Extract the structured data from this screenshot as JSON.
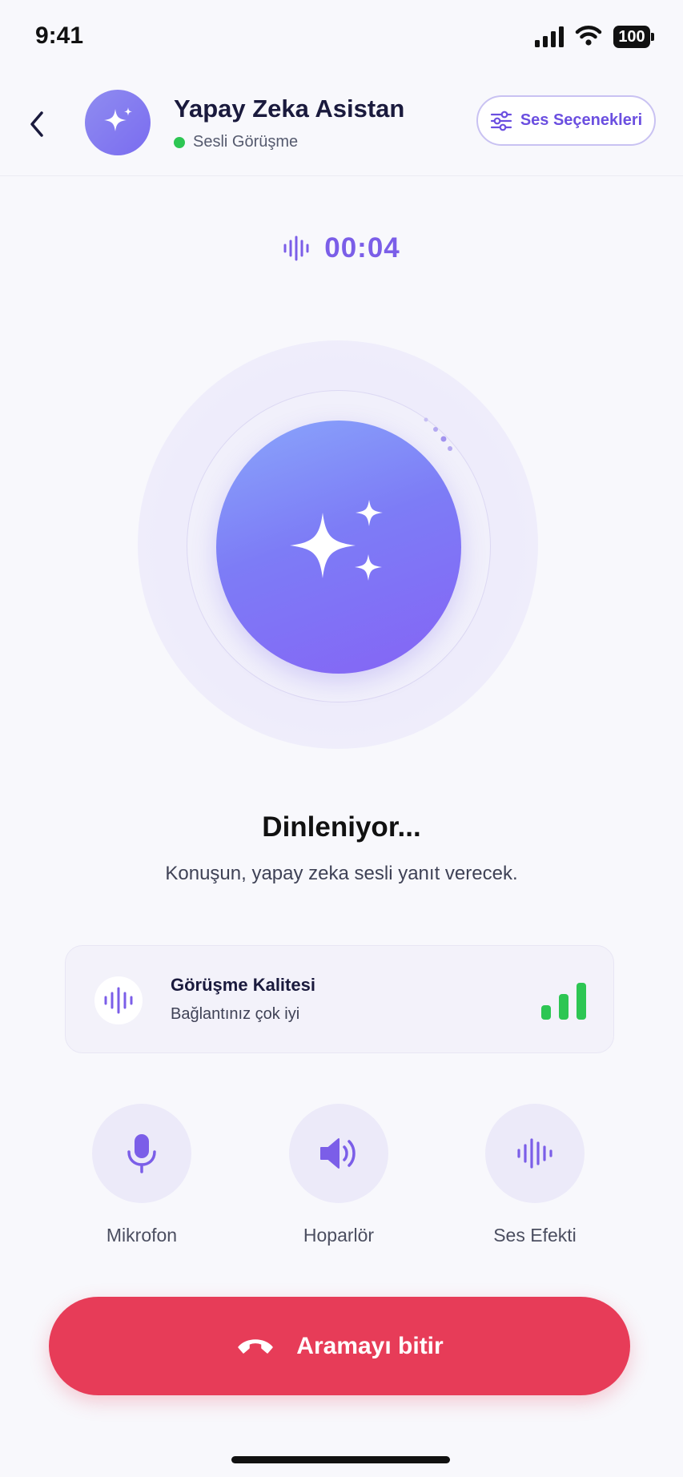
{
  "status_bar": {
    "time": "9:41",
    "battery": "100"
  },
  "header": {
    "title": "Yapay Zeka Asistan",
    "status": "Sesli Görüşme",
    "status_color": "#2dc653",
    "options_label": "Ses Seçenekleri",
    "avatar_icon": "sparkle-icon"
  },
  "timer": {
    "value": "00:04",
    "icon": "waveform-icon"
  },
  "orb": {
    "icon": "sparkles-icon",
    "accent": "#7d6cf6"
  },
  "listening": {
    "title": "Dinleniyor...",
    "subtitle": "Konuşun, yapay zeka sesli yanıt verecek."
  },
  "quality": {
    "title": "Görüşme Kalitesi",
    "subtitle": "Bağlantınız çok iyi",
    "signal_level": 1.0,
    "signal_color": "#2dc653"
  },
  "controls": [
    {
      "label": "Mikrofon",
      "icon": "microphone-icon"
    },
    {
      "label": "Hoparlör",
      "icon": "speaker-icon"
    },
    {
      "label": "Ses Efekti",
      "icon": "waveform-icon"
    }
  ],
  "end_call": {
    "label": "Aramayı bitir",
    "color": "#e73c58",
    "icon": "hang-up-icon"
  }
}
